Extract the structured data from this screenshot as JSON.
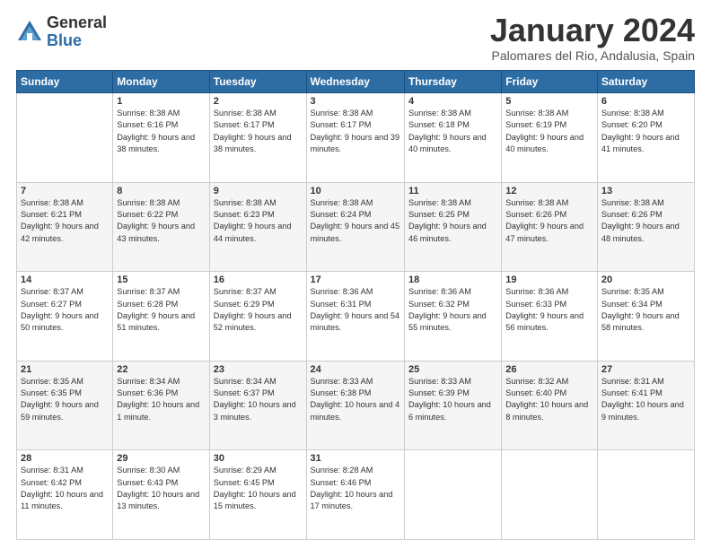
{
  "logo": {
    "general": "General",
    "blue": "Blue"
  },
  "title": "January 2024",
  "subtitle": "Palomares del Rio, Andalusia, Spain",
  "days_header": [
    "Sunday",
    "Monday",
    "Tuesday",
    "Wednesday",
    "Thursday",
    "Friday",
    "Saturday"
  ],
  "weeks": [
    [
      {
        "num": "",
        "info": ""
      },
      {
        "num": "1",
        "info": "Sunrise: 8:38 AM\nSunset: 6:16 PM\nDaylight: 9 hours\nand 38 minutes."
      },
      {
        "num": "2",
        "info": "Sunrise: 8:38 AM\nSunset: 6:17 PM\nDaylight: 9 hours\nand 38 minutes."
      },
      {
        "num": "3",
        "info": "Sunrise: 8:38 AM\nSunset: 6:17 PM\nDaylight: 9 hours\nand 39 minutes."
      },
      {
        "num": "4",
        "info": "Sunrise: 8:38 AM\nSunset: 6:18 PM\nDaylight: 9 hours\nand 40 minutes."
      },
      {
        "num": "5",
        "info": "Sunrise: 8:38 AM\nSunset: 6:19 PM\nDaylight: 9 hours\nand 40 minutes."
      },
      {
        "num": "6",
        "info": "Sunrise: 8:38 AM\nSunset: 6:20 PM\nDaylight: 9 hours\nand 41 minutes."
      }
    ],
    [
      {
        "num": "7",
        "info": "Sunrise: 8:38 AM\nSunset: 6:21 PM\nDaylight: 9 hours\nand 42 minutes."
      },
      {
        "num": "8",
        "info": "Sunrise: 8:38 AM\nSunset: 6:22 PM\nDaylight: 9 hours\nand 43 minutes."
      },
      {
        "num": "9",
        "info": "Sunrise: 8:38 AM\nSunset: 6:23 PM\nDaylight: 9 hours\nand 44 minutes."
      },
      {
        "num": "10",
        "info": "Sunrise: 8:38 AM\nSunset: 6:24 PM\nDaylight: 9 hours\nand 45 minutes."
      },
      {
        "num": "11",
        "info": "Sunrise: 8:38 AM\nSunset: 6:25 PM\nDaylight: 9 hours\nand 46 minutes."
      },
      {
        "num": "12",
        "info": "Sunrise: 8:38 AM\nSunset: 6:26 PM\nDaylight: 9 hours\nand 47 minutes."
      },
      {
        "num": "13",
        "info": "Sunrise: 8:38 AM\nSunset: 6:26 PM\nDaylight: 9 hours\nand 48 minutes."
      }
    ],
    [
      {
        "num": "14",
        "info": "Sunrise: 8:37 AM\nSunset: 6:27 PM\nDaylight: 9 hours\nand 50 minutes."
      },
      {
        "num": "15",
        "info": "Sunrise: 8:37 AM\nSunset: 6:28 PM\nDaylight: 9 hours\nand 51 minutes."
      },
      {
        "num": "16",
        "info": "Sunrise: 8:37 AM\nSunset: 6:29 PM\nDaylight: 9 hours\nand 52 minutes."
      },
      {
        "num": "17",
        "info": "Sunrise: 8:36 AM\nSunset: 6:31 PM\nDaylight: 9 hours\nand 54 minutes."
      },
      {
        "num": "18",
        "info": "Sunrise: 8:36 AM\nSunset: 6:32 PM\nDaylight: 9 hours\nand 55 minutes."
      },
      {
        "num": "19",
        "info": "Sunrise: 8:36 AM\nSunset: 6:33 PM\nDaylight: 9 hours\nand 56 minutes."
      },
      {
        "num": "20",
        "info": "Sunrise: 8:35 AM\nSunset: 6:34 PM\nDaylight: 9 hours\nand 58 minutes."
      }
    ],
    [
      {
        "num": "21",
        "info": "Sunrise: 8:35 AM\nSunset: 6:35 PM\nDaylight: 9 hours\nand 59 minutes."
      },
      {
        "num": "22",
        "info": "Sunrise: 8:34 AM\nSunset: 6:36 PM\nDaylight: 10 hours\nand 1 minute."
      },
      {
        "num": "23",
        "info": "Sunrise: 8:34 AM\nSunset: 6:37 PM\nDaylight: 10 hours\nand 3 minutes."
      },
      {
        "num": "24",
        "info": "Sunrise: 8:33 AM\nSunset: 6:38 PM\nDaylight: 10 hours\nand 4 minutes."
      },
      {
        "num": "25",
        "info": "Sunrise: 8:33 AM\nSunset: 6:39 PM\nDaylight: 10 hours\nand 6 minutes."
      },
      {
        "num": "26",
        "info": "Sunrise: 8:32 AM\nSunset: 6:40 PM\nDaylight: 10 hours\nand 8 minutes."
      },
      {
        "num": "27",
        "info": "Sunrise: 8:31 AM\nSunset: 6:41 PM\nDaylight: 10 hours\nand 9 minutes."
      }
    ],
    [
      {
        "num": "28",
        "info": "Sunrise: 8:31 AM\nSunset: 6:42 PM\nDaylight: 10 hours\nand 11 minutes."
      },
      {
        "num": "29",
        "info": "Sunrise: 8:30 AM\nSunset: 6:43 PM\nDaylight: 10 hours\nand 13 minutes."
      },
      {
        "num": "30",
        "info": "Sunrise: 8:29 AM\nSunset: 6:45 PM\nDaylight: 10 hours\nand 15 minutes."
      },
      {
        "num": "31",
        "info": "Sunrise: 8:28 AM\nSunset: 6:46 PM\nDaylight: 10 hours\nand 17 minutes."
      },
      {
        "num": "",
        "info": ""
      },
      {
        "num": "",
        "info": ""
      },
      {
        "num": "",
        "info": ""
      }
    ]
  ]
}
